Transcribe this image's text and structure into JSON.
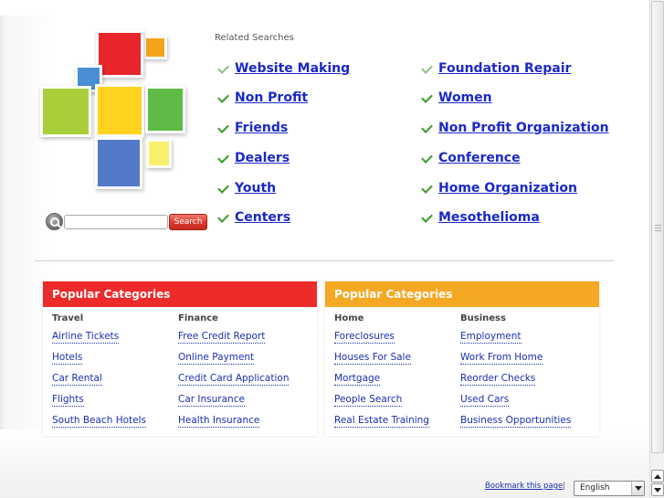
{
  "logo": {
    "colors": {
      "orange": "#f5a31a",
      "red": "#e8252b",
      "blue_small": "#4a8fd6",
      "green_lime": "#a8cf3a",
      "yellow": "#ffd21f",
      "green": "#5dbb46",
      "blue": "#5479c8",
      "yellow_light": "#f6f06a"
    }
  },
  "search": {
    "input_value": "",
    "button_label": "Search"
  },
  "related": {
    "title": "Related Searches",
    "left": [
      "Website Making",
      "Non Profit",
      "Friends",
      "Dealers",
      "Youth",
      "Centers"
    ],
    "right": [
      "Foundation Repair",
      "Women",
      "Non Profit Organization",
      "Conference",
      "Home Organization",
      "Mesothelioma"
    ]
  },
  "categories": [
    {
      "header": "Popular Categories",
      "color": "#ec2b2a",
      "columns": [
        {
          "title": "Travel",
          "links": [
            "Airline Tickets",
            "Hotels",
            "Car Rental",
            "Flights",
            "South Beach Hotels"
          ]
        },
        {
          "title": "Finance",
          "links": [
            "Free Credit Report",
            "Online Payment",
            "Credit Card Application",
            "Car Insurance",
            "Health Insurance"
          ]
        }
      ]
    },
    {
      "header": "Popular Categories",
      "color": "#f5a824",
      "columns": [
        {
          "title": "Home",
          "links": [
            "Foreclosures",
            "Houses For Sale",
            "Mortgage",
            "People Search",
            "Real Estate Training"
          ]
        },
        {
          "title": "Business",
          "links": [
            "Employment",
            "Work From Home",
            "Reorder Checks",
            "Used Cars",
            "Business Opportunities"
          ]
        }
      ]
    }
  ],
  "footer": {
    "bookmark": "Bookmark this page",
    "separator": "|",
    "language": "English"
  },
  "icons": {
    "check": "checkmark-icon",
    "search": "magnifier-icon",
    "dropdown": "chevron-down-icon"
  }
}
